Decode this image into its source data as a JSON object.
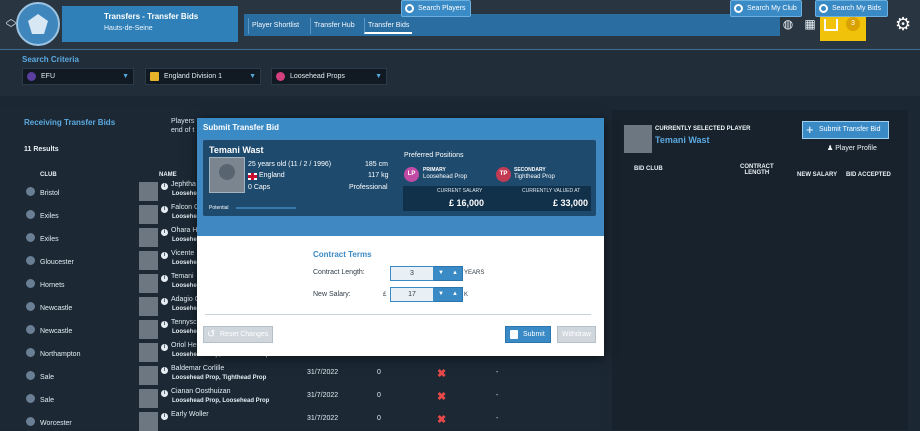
{
  "header": {
    "title": "Transfers - Transfer Bids",
    "subtitle": "Hauts-de-Seine",
    "tabs": [
      {
        "label": "Player Shortlist"
      },
      {
        "label": "Transfer Hub"
      },
      {
        "label": "Transfer Bids"
      }
    ],
    "mail_count": "3",
    "accent_color": "#2f80b8",
    "mail_color": "#f0c20a"
  },
  "search": {
    "title": "Search Criteria",
    "federation": "EFU",
    "division": "England Division 1",
    "position": "Loosehead Props",
    "search_players_label": "Search Players",
    "search_my_club_label": "Search My Club",
    "search_my_bids_label": "Search My Bids"
  },
  "receiving": {
    "title": "Receiving Transfer Bids",
    "note_line1": "Players",
    "note_line2": "end of t",
    "results": "11 Results",
    "col_club": "CLUB",
    "col_name": "NAME",
    "rows": [
      {
        "club": "Bristol",
        "name": "Jephtha",
        "pos": "Loosehea",
        "date": "",
        "bids": "",
        "acc": "",
        "fee": ""
      },
      {
        "club": "Exiles",
        "name": "Falcon G",
        "pos": "Loosehea",
        "date": "",
        "bids": "",
        "acc": "",
        "fee": ""
      },
      {
        "club": "Exiles",
        "name": "Ohara H",
        "pos": "Loosehea",
        "date": "",
        "bids": "",
        "acc": "",
        "fee": ""
      },
      {
        "club": "Gloucester",
        "name": "Vicente",
        "pos": "Loosehea",
        "date": "",
        "bids": "",
        "acc": "",
        "fee": ""
      },
      {
        "club": "Hornets",
        "name": "Temani",
        "pos": "Loosehea",
        "date": "",
        "bids": "",
        "acc": "",
        "fee": ""
      },
      {
        "club": "Newcastle",
        "name": "Adagio C",
        "pos": "Loosehea",
        "date": "",
        "bids": "",
        "acc": "",
        "fee": ""
      },
      {
        "club": "Newcastle",
        "name": "Tennysc",
        "pos": "Loosehea",
        "date": "",
        "bids": "",
        "acc": "",
        "fee": ""
      },
      {
        "club": "Northampton",
        "name": "Oriol He",
        "pos": "Loosehead Prop, Loosehead Prop",
        "date": "31/7/2022",
        "bids": "0",
        "acc": "✖",
        "fee": "-"
      },
      {
        "club": "Sale",
        "name": "Baldemar Corlille",
        "pos": "Loosehead Prop, Tighthead Prop",
        "date": "31/7/2022",
        "bids": "0",
        "acc": "✖",
        "fee": "-"
      },
      {
        "club": "Sale",
        "name": "Cianan Oosthuizan",
        "pos": "Loosehead Prop, Loosehead Prop",
        "date": "31/7/2022",
        "bids": "0",
        "acc": "✖",
        "fee": "-"
      },
      {
        "club": "Worcester",
        "name": "Early Woller",
        "pos": "",
        "date": "31/7/2022",
        "bids": "0",
        "acc": "✖",
        "fee": "-"
      }
    ]
  },
  "selected": {
    "label": "CURRENTLY SELECTED PLAYER",
    "name": "Temani Wast",
    "submit_bid_label": "Submit Transfer Bid",
    "profile_label": "Player Profile",
    "col_bid_club": "BID CLUB",
    "col_contract_1": "CONTRACT",
    "col_contract_2": "LENGTH",
    "col_new_salary": "NEW SALARY",
    "col_bid_accepted": "BID ACCEPTED"
  },
  "modal": {
    "title": "Submit Transfer Bid",
    "player_name": "Temani Wast",
    "age": "25 years old (11 / 2 / 1996)",
    "nation": "England",
    "caps": "0 Caps",
    "height": "185 cm",
    "weight": "117 kg",
    "status": "Professional",
    "potential_label": "Potential",
    "pref_title": "Preferred Positions",
    "primary_badge": "LP",
    "primary_label": "PRIMARY",
    "primary_pos": "Loosehead Prop",
    "secondary_badge": "TP",
    "secondary_label": "SECONDARY",
    "secondary_pos": "Tighthead Prop",
    "current_salary_label": "CURRENT SALARY",
    "current_salary": "£ 16,000",
    "valued_label": "CURRENTLY VALUED AT",
    "valued": "£ 33,000",
    "contract_title": "Contract Terms",
    "contract_length_label": "Contract Length:",
    "contract_length_value": "3",
    "contract_length_unit": "YEARS",
    "salary_label": "New Salary:",
    "salary_prefix": "£",
    "salary_value": "17",
    "salary_unit": "K",
    "reset_label": "Reset Changes",
    "submit_label": "Submit",
    "withdraw_label": "Withdraw"
  }
}
